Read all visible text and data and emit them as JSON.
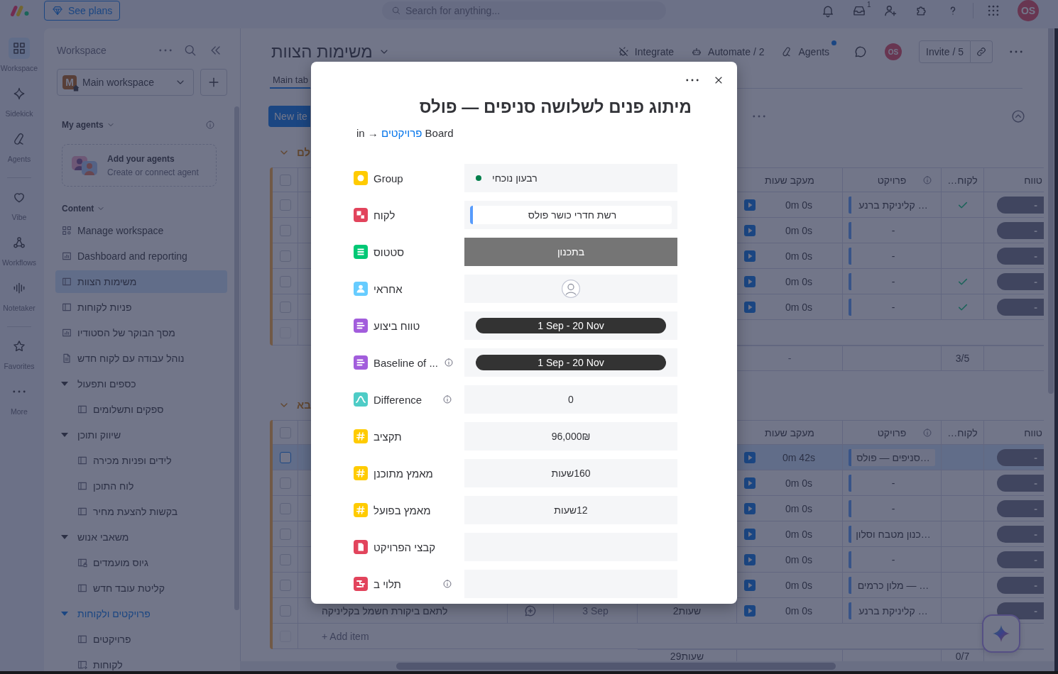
{
  "top_bar": {
    "see_plans": "See plans",
    "search": {
      "placeholder": "Search for anything..."
    },
    "inbox_count": "1",
    "avatar": "OS"
  },
  "rail": {
    "sections": [
      {
        "items": [
          {
            "label": "Workspace",
            "selected": true
          },
          {
            "label": "Sidekick",
            "selected": false
          },
          {
            "label": "Agents",
            "selected": false
          }
        ]
      },
      {
        "items": [
          {
            "label": "Vibe",
            "selected": false
          },
          {
            "label": "Workflows",
            "selected": false
          },
          {
            "label": "Notetaker",
            "selected": false
          }
        ]
      },
      {
        "items": [
          {
            "label": "Favorites",
            "selected": false
          },
          {
            "label": "More",
            "selected": false
          }
        ]
      }
    ]
  },
  "sidebar": {
    "title": "Workspace",
    "workspace": {
      "initial": "M",
      "name": "Main workspace"
    },
    "agents": {
      "heading": "My agents",
      "card_title": "Add your agents",
      "card_subtitle": "Create or connect agent"
    },
    "content_heading": "Content",
    "items": [
      {
        "kind": "manage",
        "label": "Manage workspace",
        "selected": false
      },
      {
        "kind": "dashboard",
        "label": "Dashboard and reporting",
        "selected": false
      },
      {
        "kind": "board",
        "label": "משימות הצוות",
        "selected": true
      },
      {
        "kind": "board",
        "label": "פניות לקוחות",
        "selected": false
      },
      {
        "kind": "dashboard",
        "label": "מסך הבוקר של הסטודיו",
        "selected": false
      },
      {
        "kind": "doc",
        "label": "נוהל עבודה עם לקוח חדש",
        "selected": false
      },
      {
        "kind": "folder",
        "label": "כספים ותפעול",
        "expanded": true,
        "active": false,
        "children": [
          {
            "kind": "board",
            "label": "ספקים ותשלומים",
            "selected": false
          }
        ]
      },
      {
        "kind": "folder",
        "label": "שיווק ותוכן",
        "expanded": true,
        "active": false,
        "children": [
          {
            "kind": "board",
            "label": "לידים ופניות מכירה",
            "selected": false
          },
          {
            "kind": "board",
            "label": "לוח התוכן",
            "selected": false
          },
          {
            "kind": "board",
            "label": "בקשות להצעת מחיר",
            "selected": false
          }
        ]
      },
      {
        "kind": "folder",
        "label": "משאבי אנוש",
        "expanded": true,
        "active": false,
        "children": [
          {
            "kind": "private_board",
            "label": "גיוס מועמדים",
            "selected": false
          },
          {
            "kind": "board",
            "label": "קליטת עובד חדש",
            "selected": false
          }
        ]
      },
      {
        "kind": "folder",
        "label": "פרויקטים ולקוחות",
        "expanded": true,
        "active": true,
        "children": [
          {
            "kind": "board",
            "label": "פרויקטים",
            "selected": false
          },
          {
            "kind": "shared_board",
            "label": "לקוחות",
            "selected": false
          }
        ]
      }
    ]
  },
  "board": {
    "title": "משימות הצוות",
    "integrate": "Integrate",
    "automate": "Automate / 2",
    "agents": {
      "label": "Agents",
      "unread": true
    },
    "avatar": "OS",
    "invite": "Invite / 5",
    "tabs": [
      {
        "label": "Main tab",
        "selected": true
      }
    ],
    "new_item": "New ite"
  },
  "groups": [
    {
      "title": "לם",
      "expanded": true,
      "all_selected": false,
      "columns": [
        {
          "label": "טווח"
        },
        {
          "label": "לקוח…"
        },
        {
          "label": "פרויקט",
          "info": true
        },
        {
          "label": "מעקב שעות"
        }
      ],
      "rows": [
        {
          "selected": false,
          "time": "0m 0s",
          "project": "… קליניקת ברנע",
          "checked": true,
          "range": "-"
        },
        {
          "selected": false,
          "time": "0m 0s",
          "project": "-",
          "checked": false,
          "range": "-"
        },
        {
          "selected": false,
          "time": "0m 0s",
          "project": "-",
          "checked": false,
          "range": "-"
        },
        {
          "selected": false,
          "time": "0m 0s",
          "project": "-",
          "checked": true,
          "range": "-"
        },
        {
          "selected": false,
          "time": "0m 0s",
          "project": "-",
          "checked": true,
          "range": "-"
        }
      ],
      "add_row": {
        "disabled": true
      },
      "summary": {
        "time": "-",
        "check_count": "3/5"
      }
    },
    {
      "title": "בא",
      "expanded": true,
      "all_selected": false,
      "columns": [
        {
          "label": "טווח"
        },
        {
          "label": "לקוח…"
        },
        {
          "label": "פרויקט",
          "info": true
        },
        {
          "label": "מעקב שעות"
        }
      ],
      "rows": [
        {
          "selected": true,
          "time": "0m 42s",
          "project": "…סניפים — פולס",
          "checked": false,
          "range": "-"
        },
        {
          "selected": false,
          "time": "0m 0s",
          "project": "-",
          "checked": false,
          "range": "-"
        },
        {
          "selected": false,
          "time": "0m 0s",
          "project": "-",
          "checked": false,
          "range": "-"
        },
        {
          "selected": false,
          "time": "0m 0s",
          "project": "…כנון מטבח וסלון",
          "checked": false,
          "range": "-"
        },
        {
          "selected": false,
          "time": "0m 0s",
          "project": "-",
          "checked": false,
          "range": "-"
        },
        {
          "selected": false,
          "time": "0m 0s",
          "project": "… — מלון כרמים",
          "checked": false,
          "range": "-"
        },
        {
          "selected": false,
          "name": "לתאם ביקורת חשמל בקליניקה",
          "date": "3 Sep",
          "effort": "2שעות",
          "time": "0m 0s",
          "project": "… קליניקת ברנע",
          "checked": false,
          "range": "-"
        }
      ],
      "add_row": {
        "label": "+ Add item",
        "disabled": true
      },
      "summary": {
        "effort": "29שעות",
        "check_count": "0/7"
      }
    }
  ],
  "item_modal": {
    "title": "מיתוג פנים לשלושה סניפים — פולס",
    "breadcrumb": {
      "prefix": "in →",
      "board": "פרויקטים",
      "suffix": "Board"
    },
    "fields": [
      {
        "kind": "group",
        "label": "Group",
        "value": "רבעון נוכחי",
        "color": "#037f4c"
      },
      {
        "kind": "connect",
        "label": "לקוח",
        "value": "רשת חדרי כושר פולס"
      },
      {
        "kind": "status",
        "label": "סטטוס",
        "value": "בתכנון",
        "color": "#757575"
      },
      {
        "kind": "people",
        "label": "אחראי"
      },
      {
        "kind": "timeline",
        "label": "טווח ביצוע",
        "value": "1 Sep - 20 Nov"
      },
      {
        "kind": "timeline",
        "label": "Baseline of ...",
        "info": true,
        "value": "1 Sep - 20 Nov"
      },
      {
        "kind": "formula",
        "label": "Difference",
        "info": true,
        "value": "0"
      },
      {
        "kind": "numbers",
        "label": "תקציב",
        "value": "96,000₪"
      },
      {
        "kind": "numbers",
        "label": "מאמץ מתוכנן",
        "value": "160שעות"
      },
      {
        "kind": "numbers",
        "label": "מאמץ בפועל",
        "value": "12שעות"
      },
      {
        "kind": "file",
        "label": "קבצי הפרויקט"
      },
      {
        "kind": "dependency",
        "label": "תלוי ב",
        "info": true
      }
    ]
  }
}
